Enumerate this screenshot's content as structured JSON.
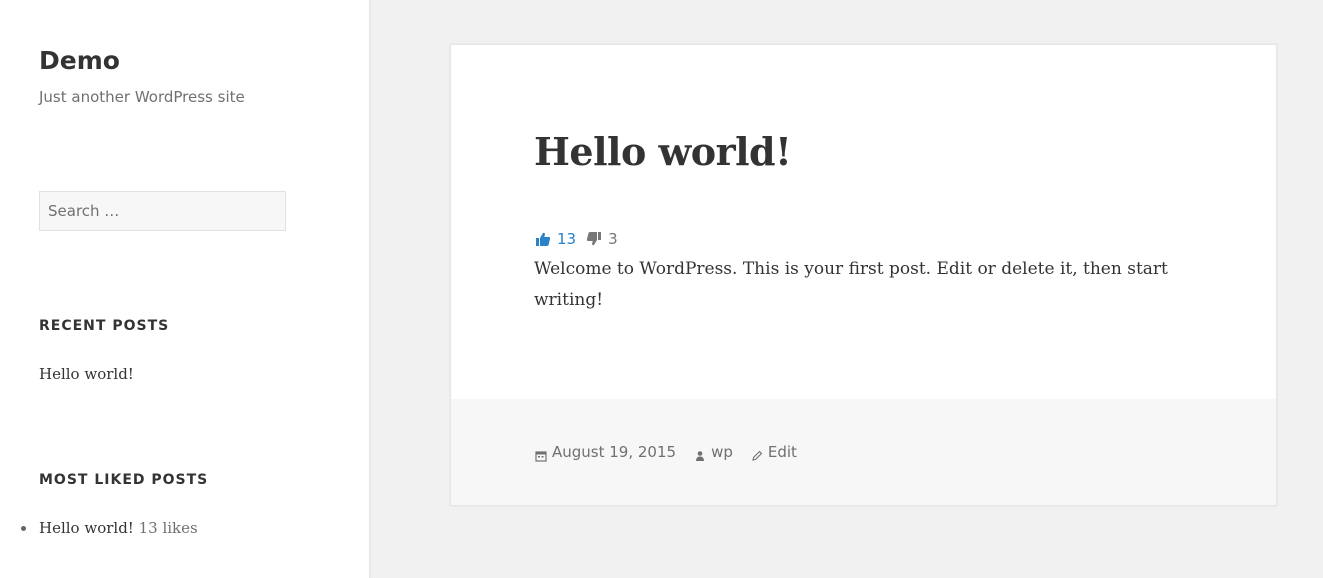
{
  "site": {
    "title": "Demo",
    "description": "Just another WordPress site"
  },
  "search": {
    "placeholder": "Search …"
  },
  "widgets": {
    "recent_posts": {
      "title": "RECENT POSTS",
      "items": [
        "Hello world!"
      ]
    },
    "most_liked": {
      "title": "MOST LIKED POSTS",
      "items": [
        {
          "title": "Hello world!",
          "count": "13 likes"
        }
      ]
    }
  },
  "post": {
    "title": "Hello world!",
    "likes": "13",
    "dislikes": "3",
    "content": "Welcome to WordPress. This is your first post. Edit or delete it, then start writing!",
    "meta": {
      "date": "August 19, 2015",
      "author": "wp",
      "edit": "Edit"
    }
  },
  "icons": {
    "thumbs_up": "thumbs-up-icon",
    "thumbs_down": "thumbs-down-icon",
    "calendar": "calendar-icon",
    "author": "author-icon",
    "edit": "pencil-icon"
  },
  "colors": {
    "background": "#f1f1f1",
    "panel": "#ffffff",
    "footer": "#f7f7f7",
    "text": "#333333",
    "muted": "#707070",
    "like_accent": "#2a82c9"
  }
}
